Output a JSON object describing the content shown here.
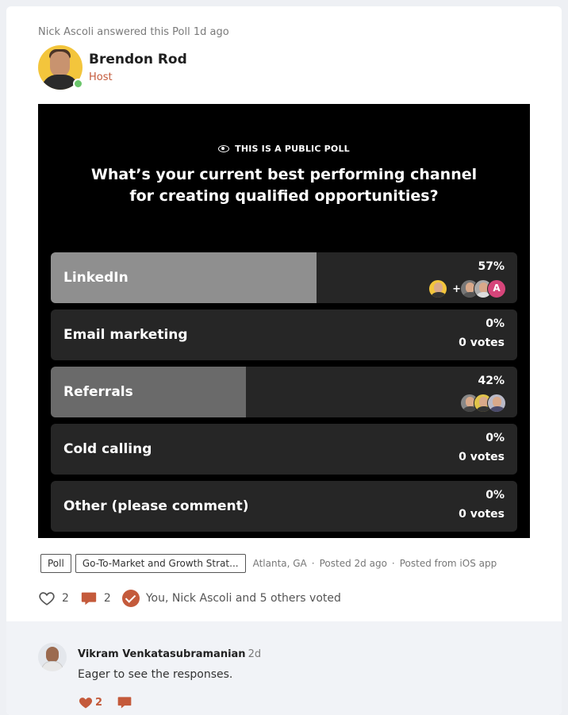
{
  "colors": {
    "accent": "#c45a3b",
    "online": "#6ac56b",
    "poll_bg": "#000000",
    "option_bg": "#262626"
  },
  "post": {
    "activity": "Nick Ascoli answered this Poll 1d ago",
    "author": "Brendon Rod",
    "role": "Host"
  },
  "poll": {
    "visibility_icon": "eye-icon",
    "visibility": "THIS IS A PUBLIC POLL",
    "question": "What’s your current best performing channel for creating qualified opportunities?",
    "options": [
      {
        "label": "LinkedIn",
        "percent": "57%",
        "votes": "",
        "fraction": 0.57,
        "fill": "#8f8f8f",
        "voters": "+",
        "voter_letter": "A"
      },
      {
        "label": "Email marketing",
        "percent": "0%",
        "votes": "0 votes",
        "fraction": 0.0
      },
      {
        "label": "Referrals",
        "percent": "42%",
        "votes": "",
        "fraction": 0.42,
        "fill": "#6a6a6a"
      },
      {
        "label": "Cold calling",
        "percent": "0%",
        "votes": "0 votes",
        "fraction": 0.0
      },
      {
        "label": "Other (please comment)",
        "percent": "0%",
        "votes": "0 votes",
        "fraction": 0.0
      }
    ]
  },
  "tags": {
    "type": "Poll",
    "category": "Go-To-Market and Growth Strat...",
    "location": "Atlanta, GA",
    "posted": "Posted 2d ago",
    "source": "Posted from iOS app",
    "separator": "·"
  },
  "actions": {
    "likes": "2",
    "comments": "2",
    "voted": "You, Nick Ascoli and 5 others voted"
  },
  "comment": {
    "author": "Vikram Venkatasubramanian",
    "time": "2d",
    "text": "Eager to see the responses.",
    "likes": "2"
  }
}
